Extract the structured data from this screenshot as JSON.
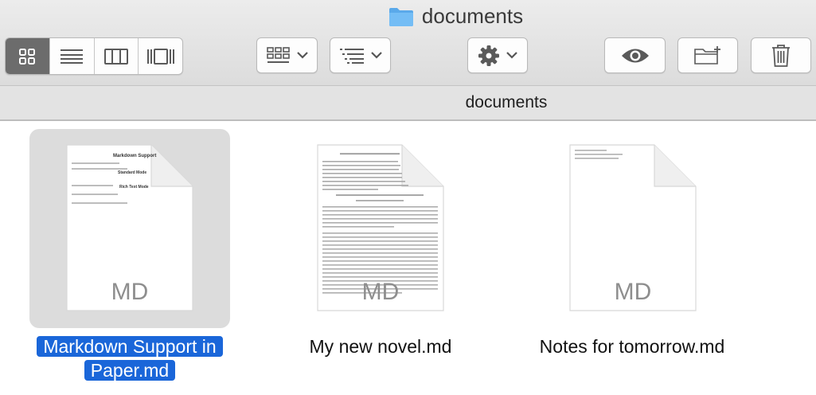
{
  "window": {
    "title": "documents"
  },
  "toolbar": {
    "view_modes": [
      {
        "id": "icon",
        "icon": "grid-icon",
        "active": true
      },
      {
        "id": "list",
        "icon": "list-icon",
        "active": false
      },
      {
        "id": "column",
        "icon": "columns-icon",
        "active": false
      },
      {
        "id": "gallery",
        "icon": "gallery-icon",
        "active": false
      }
    ],
    "group_button_icon": "group-icon",
    "sort_button_icon": "sort-icon",
    "action_button_icon": "gear-icon",
    "quicklook_icon": "eye-icon",
    "new_folder_icon": "new-folder-icon",
    "trash_icon": "trash-icon",
    "accent_color": "#1a66d9"
  },
  "pathbar": {
    "current": "documents"
  },
  "files": [
    {
      "name_line1": "Markdown Support in",
      "name_line2": "Paper.md",
      "ext": "MD",
      "selected": true
    },
    {
      "name": "My new novel.md",
      "ext": "MD",
      "selected": false
    },
    {
      "name": "Notes for tomorrow.md",
      "ext": "MD",
      "selected": false
    }
  ],
  "preview1": {
    "heading": "Markdown Support",
    "section1": "Standard Mode",
    "section2": "Rich Text Mode"
  }
}
